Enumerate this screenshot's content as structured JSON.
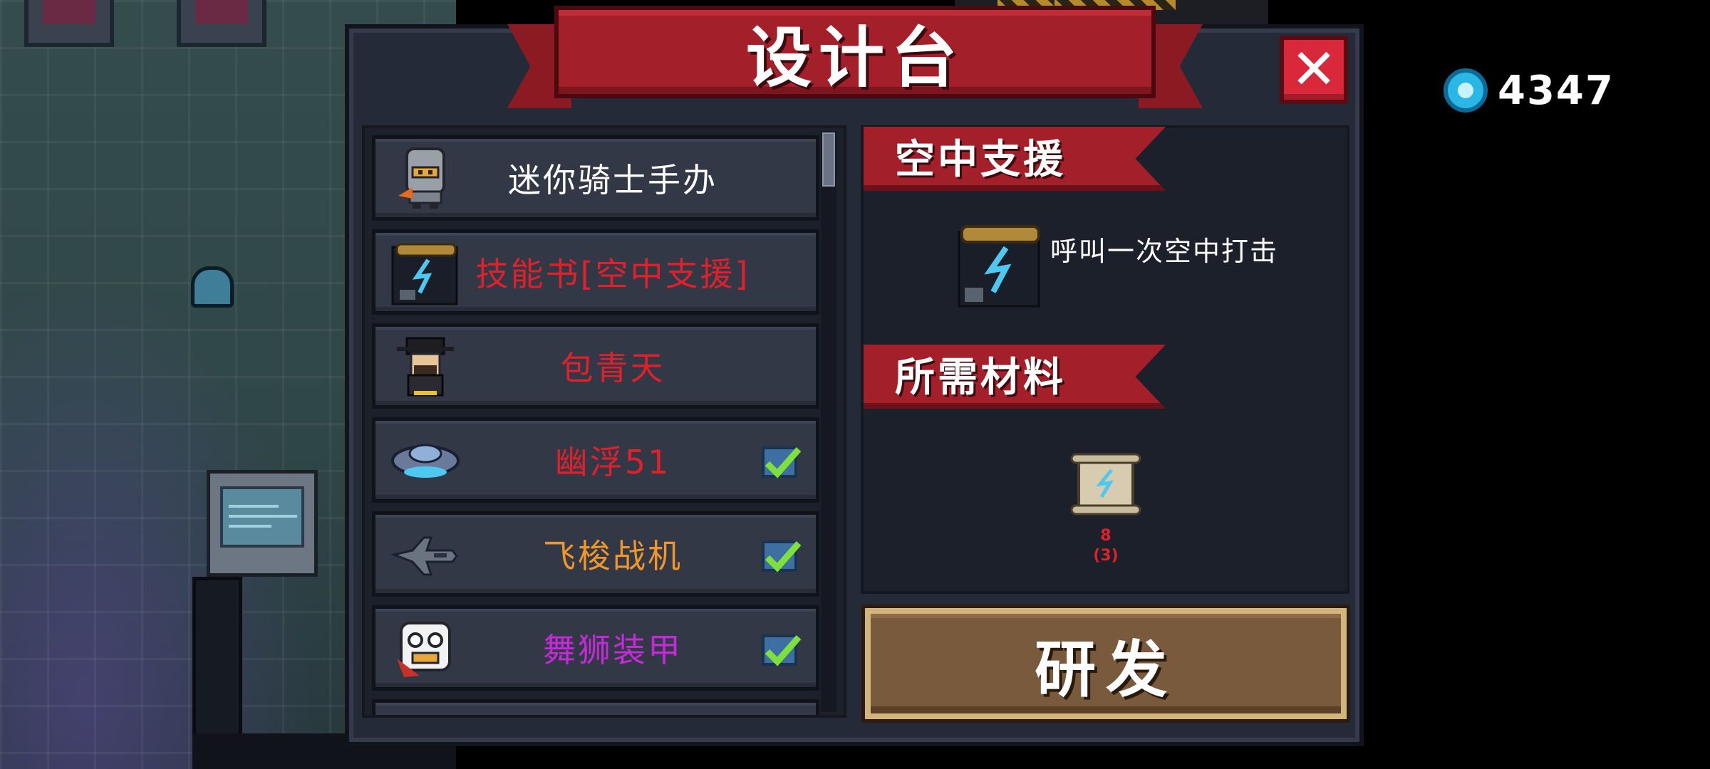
{
  "title": "设计台",
  "currency": {
    "icon": "gem-icon",
    "amount": "4347"
  },
  "items": [
    {
      "label": "迷你骑士手办",
      "color": "#ffffff",
      "icon": "knight-figure-icon",
      "checked": false
    },
    {
      "label": "技能书[空中支援]",
      "color": "#e0202a",
      "icon": "skill-book-icon",
      "checked": false
    },
    {
      "label": "包青天",
      "color": "#e0202a",
      "icon": "judge-bao-icon",
      "checked": false
    },
    {
      "label": "幽浮51",
      "color": "#e0202a",
      "icon": "ufo-icon",
      "checked": true
    },
    {
      "label": "飞梭战机",
      "color": "#f0962a",
      "icon": "fighter-jet-icon",
      "checked": true
    },
    {
      "label": "舞狮装甲",
      "color": "#c42ad8",
      "icon": "lion-dance-icon",
      "checked": true
    }
  ],
  "detail": {
    "name": "空中支援",
    "description": "呼叫一次空中打击",
    "materials_heading": "所需材料",
    "material": {
      "icon": "blueprint-scroll-icon",
      "owned": "8",
      "required": "(3)"
    }
  },
  "research_label": "研发"
}
